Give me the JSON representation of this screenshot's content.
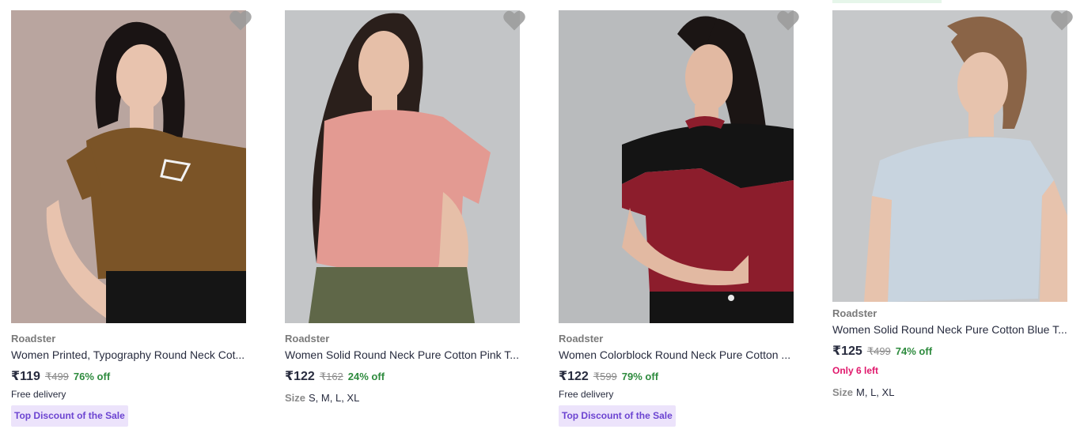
{
  "products": [
    {
      "brand": "Roadster",
      "title": "Women Printed, Typography Round Neck Cot...",
      "price": "₹119",
      "mrp": "₹499",
      "discount": "76% off",
      "delivery": "Free delivery",
      "badge": "Top Discount of the Sale",
      "wishlist_icon": "heart-icon",
      "image": {
        "bg": "#b9a59f",
        "shirt": "#7b5427",
        "skin": "#e8c3ae",
        "hair": "#1a1414",
        "pants": "#151515"
      }
    },
    {
      "brand": "Roadster",
      "title": "Women Solid Round Neck Pure Cotton Pink T...",
      "price": "₹122",
      "mrp": "₹162",
      "discount": "24% off",
      "sizes_label": "Size",
      "sizes": "S, M, L, XL",
      "wishlist_icon": "heart-icon",
      "image": {
        "bg": "#c3c5c7",
        "shirt": "#e39a92",
        "skin": "#e6bfa8",
        "hair": "#2a1f1b",
        "pants": "#5f6748"
      }
    },
    {
      "brand": "Roadster",
      "title": "Women Colorblock Round Neck Pure Cotton ...",
      "price": "₹122",
      "mrp": "₹599",
      "discount": "79% off",
      "delivery": "Free delivery",
      "badge": "Top Discount of the Sale",
      "wishlist_icon": "heart-icon",
      "image": {
        "bg": "#b9bbbd",
        "shirt": "#8c1d2c",
        "yoke": "#141414",
        "skin": "#e2b9a2",
        "hair": "#1b1514",
        "pants": "#141414"
      }
    },
    {
      "brand": "Roadster",
      "title": "Women Solid Round Neck Pure Cotton Blue T...",
      "price": "₹125",
      "mrp": "₹499",
      "discount": "74% off",
      "stock": "Only 6 left",
      "sizes_label": "Size",
      "sizes": "M, L, XL",
      "wishlist_icon": "heart-icon",
      "image": {
        "bg": "#c6c8ca",
        "shirt": "#c8d4df",
        "skin": "#e7c3ad",
        "hair": "#8a6447",
        "pants": "#c6c8ca"
      }
    }
  ]
}
